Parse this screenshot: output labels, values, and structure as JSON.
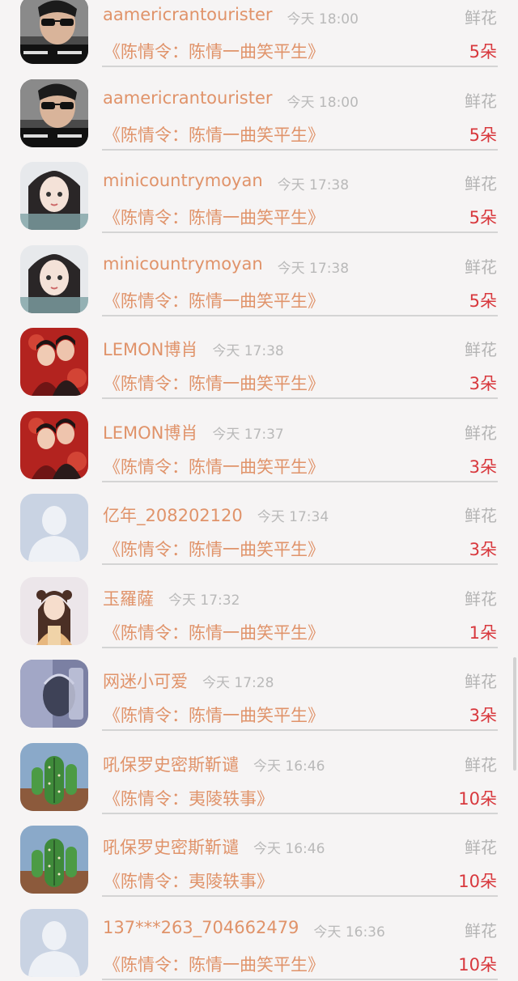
{
  "gift_label": "鲜花",
  "items": [
    {
      "name": "aamericrantourister",
      "time": "今天 18:00",
      "book": "《陈情令：陈情一曲笑平生》",
      "count": "5朵",
      "avatar": "avatar-photo-sunglasses"
    },
    {
      "name": "aamericrantourister",
      "time": "今天 18:00",
      "book": "《陈情令：陈情一曲笑平生》",
      "count": "5朵",
      "avatar": "avatar-photo-sunglasses"
    },
    {
      "name": "minicountrymoyan",
      "time": "今天 17:38",
      "book": "《陈情令：陈情一曲笑平生》",
      "count": "5朵",
      "avatar": "avatar-photo-girl"
    },
    {
      "name": "minicountrymoyan",
      "time": "今天 17:38",
      "book": "《陈情令：陈情一曲笑平生》",
      "count": "5朵",
      "avatar": "avatar-photo-girl"
    },
    {
      "name": "LEMON博肖",
      "time": "今天 17:38",
      "book": "《陈情令：陈情一曲笑平生》",
      "count": "3朵",
      "avatar": "avatar-photo-couple-red"
    },
    {
      "name": "LEMON博肖",
      "time": "今天 17:37",
      "book": "《陈情令：陈情一曲笑平生》",
      "count": "3朵",
      "avatar": "avatar-photo-couple-red"
    },
    {
      "name": "亿年_208202120",
      "time": "今天 17:34",
      "book": "《陈情令：陈情一曲笑平生》",
      "count": "3朵",
      "avatar": "avatar-default-person"
    },
    {
      "name": "玉羅薩",
      "time": "今天 17:32",
      "book": "《陈情令：陈情一曲笑平生》",
      "count": "1朵",
      "avatar": "avatar-illustration-lady"
    },
    {
      "name": "网迷小可爱",
      "time": "今天 17:28",
      "book": "《陈情令：陈情一曲笑平生》",
      "count": "3朵",
      "avatar": "avatar-photo-bluegray"
    },
    {
      "name": "吼保罗史密斯靳谴",
      "time": "今天 16:46",
      "book": "《陈情令：夷陵轶事》",
      "count": "10朵",
      "avatar": "avatar-photo-cactus"
    },
    {
      "name": "吼保罗史密斯靳谴",
      "time": "今天 16:46",
      "book": "《陈情令：夷陵轶事》",
      "count": "10朵",
      "avatar": "avatar-photo-cactus"
    },
    {
      "name": "137***263_704662479",
      "time": "今天 16:36",
      "book": "《陈情令：陈情一曲笑平生》",
      "count": "10朵",
      "avatar": "avatar-default-person"
    }
  ]
}
